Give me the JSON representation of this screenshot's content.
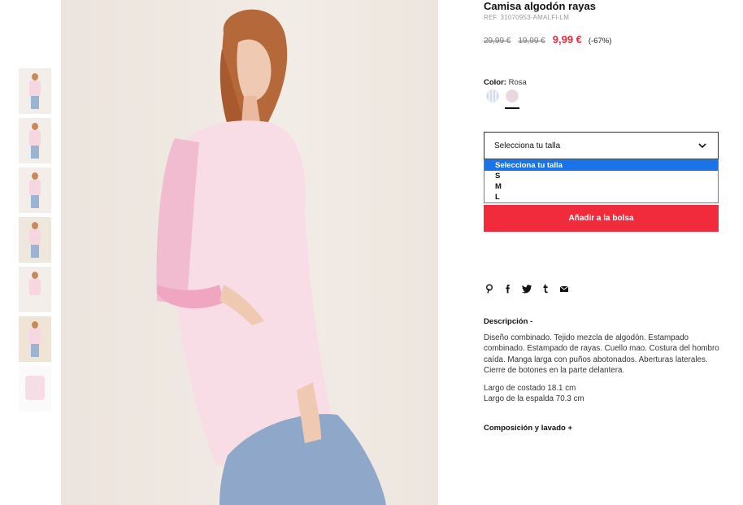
{
  "product": {
    "title": "Camisa algodón rayas",
    "ref": "REF. 31070953-AMALFI-LM",
    "prices": {
      "original": "29,99 €",
      "previous": "19,99 €",
      "current": "9,99 €",
      "discount": "(-67%)"
    },
    "color": {
      "label": "Color:",
      "value": "Rosa",
      "swatches": [
        "blue-stripes",
        "pink"
      ],
      "selected": "pink"
    },
    "size_select": {
      "placeholder": "Selecciona tu talla",
      "options": [
        "Selecciona tu talla",
        "S",
        "M",
        "L"
      ],
      "highlighted": "Selecciona tu talla"
    },
    "add_button": "Añadir a la bolsa",
    "share_icons": [
      "pinterest-icon",
      "facebook-icon",
      "twitter-icon",
      "tumblr-icon",
      "email-icon"
    ],
    "description": {
      "heading": "Descripción -",
      "text": "Diseño combinado. Tejido mezcla de algodón. Estampado combinado. Estampado de rayas. Cuello mao. Costura del hombro caída. Manga larga con puños abotonados. Aberturas laterales. Cierre de botones en la parte delantera.",
      "measure_1": "Largo de costado 18.1 cm",
      "measure_2": "Largo de la espalda 70.3 cm"
    },
    "composition": "Composición y lavado +"
  },
  "colors": {
    "accent": "#f12a3c",
    "price_red": "#e8293b",
    "select_highlight": "#1a73e8"
  }
}
